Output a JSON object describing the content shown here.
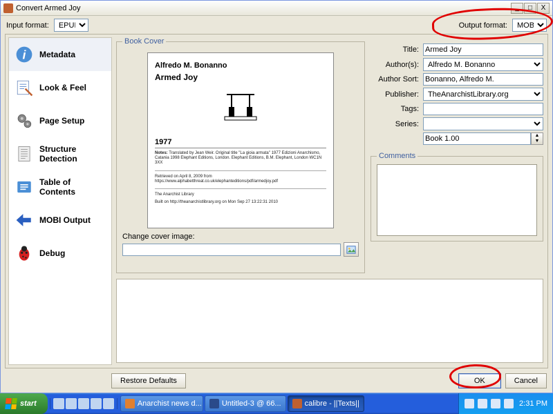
{
  "window": {
    "title": "Convert Armed Joy",
    "minimize": "_",
    "maximize": "□",
    "close": "X"
  },
  "formatRow": {
    "inputLabel": "Input format:",
    "inputValue": "EPUB",
    "outputLabel": "Output format:",
    "outputValue": "MOBI"
  },
  "sidebar": {
    "items": [
      {
        "label": "Metadata",
        "icon": "info"
      },
      {
        "label": "Look & Feel",
        "icon": "lookfeel"
      },
      {
        "label": "Page Setup",
        "icon": "gears"
      },
      {
        "label": "Structure Detection",
        "icon": "structure"
      },
      {
        "label": "Table of Contents",
        "icon": "toc"
      },
      {
        "label": "MOBI Output",
        "icon": "arrow-left"
      },
      {
        "label": "Debug",
        "icon": "bug"
      }
    ]
  },
  "bookCover": {
    "legend": "Book Cover",
    "author": "Alfredo M. Bonanno",
    "title": "Armed Joy",
    "year": "1977",
    "notesLabel": "Notes:",
    "notes": "Translated by Jean Weir. Original title \"La gioia armata\" 1977 Edizioni Anarchismo, Catania 1998 Elephant Editions, London. Elephant Editions, B.M. Elephant, London WC1N 3XX",
    "retrieved": "Retrieved on April 8, 2009 from https://www.alphabetthreat.co.uk/elephanteditions/pdf/armedjoy.pdf",
    "lib": "The Anarchist Library",
    "built": "Built on http://theanarchistlibrary.org on Mon Sep 27 13:22:31 2010",
    "changeLabel": "Change cover image:",
    "changeValue": ""
  },
  "meta": {
    "titleLabel": "Title:",
    "titleValue": "Armed Joy",
    "authorsLabel": "Author(s):",
    "authorsValue": "Alfredo M. Bonanno",
    "authorSortLabel": "Author Sort:",
    "authorSortValue": "Bonanno, Alfredo M.",
    "publisherLabel": "Publisher:",
    "publisherValue": "TheAnarchistLibrary.org",
    "tagsLabel": "Tags:",
    "tagsValue": "",
    "seriesLabel": "Series:",
    "seriesValue": "",
    "bookNum": "Book 1.00",
    "commentsLegend": "Comments",
    "commentsValue": ""
  },
  "buttons": {
    "restore": "Restore Defaults",
    "ok": "OK",
    "cancel": "Cancel"
  },
  "taskbar": {
    "start": "start",
    "items": [
      {
        "label": "Anarchist news d..."
      },
      {
        "label": "Untitled-3 @ 66..."
      },
      {
        "label": "calibre - ||Texts||"
      }
    ],
    "clock": "2:31 PM"
  }
}
